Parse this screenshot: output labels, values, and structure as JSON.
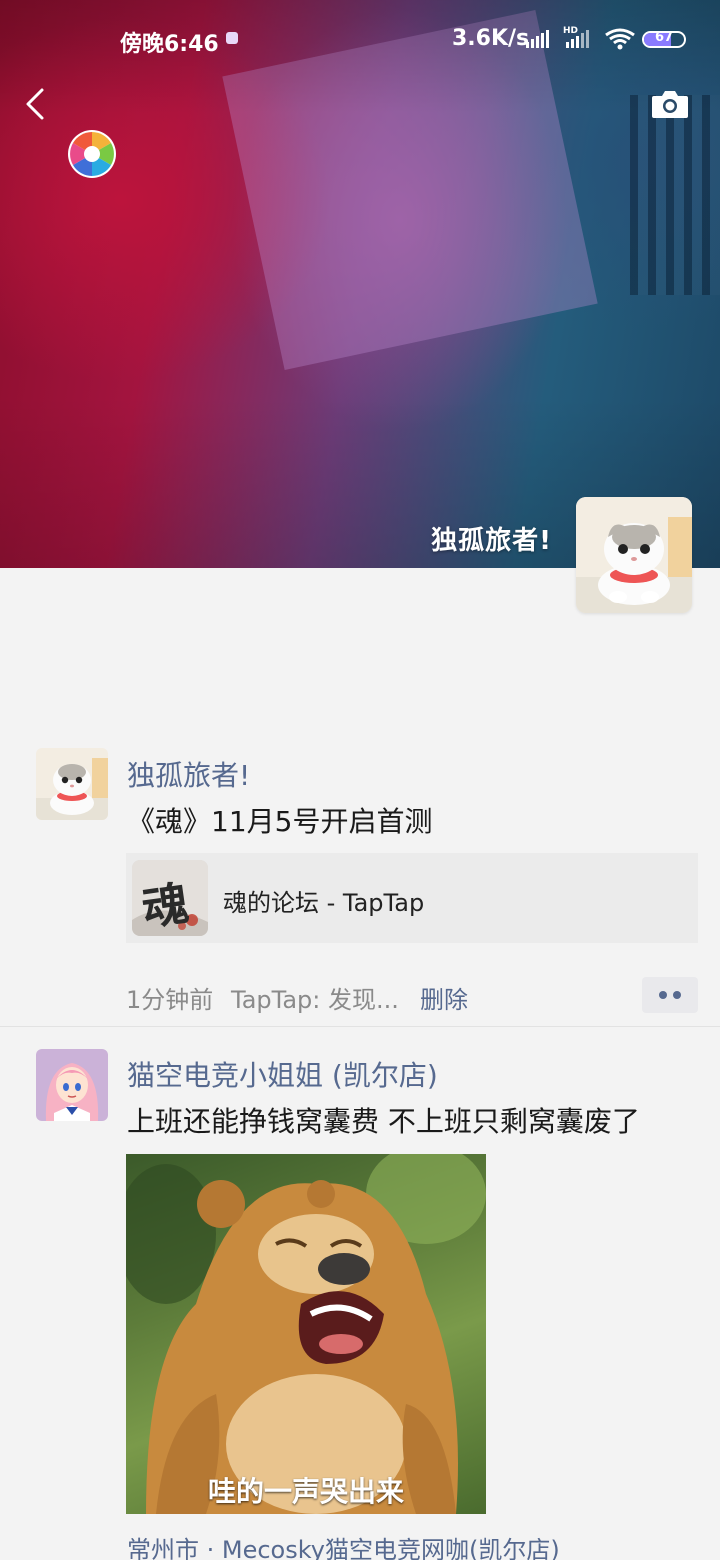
{
  "status_bar": {
    "time": "傍晚6:46",
    "network_speed": "3.6K/s",
    "hd_label": "HD",
    "battery": "67",
    "battery_level": 0.67
  },
  "cover": {
    "user_name": "独孤旅者!"
  },
  "posts": [
    {
      "name": "独孤旅者!",
      "text": "《魂》11月5号开启首测",
      "share_card": {
        "icon_char": "魂",
        "title": "魂的论坛 - TapTap"
      },
      "time": "1分钟前",
      "source": "TapTap: 发现...",
      "delete_label": "删除"
    },
    {
      "name": "猫空电竞小姐姐 (凯尔店)",
      "text": "上班还能挣钱窝囊费 不上班只剩窝囊废了",
      "image_caption": "哇的一声哭出来",
      "location": "常州市 · Mecosky猫空电竞网咖(凯尔店)"
    }
  ],
  "colors": {
    "link": "#56698f",
    "meta": "#8a8a8a",
    "background": "#f3f3f3"
  },
  "icons": [
    "back-chevron-icon",
    "camera-icon",
    "aperture-icon",
    "more-dots-icon",
    "wifi-icon",
    "signal-icon",
    "battery-icon"
  ]
}
